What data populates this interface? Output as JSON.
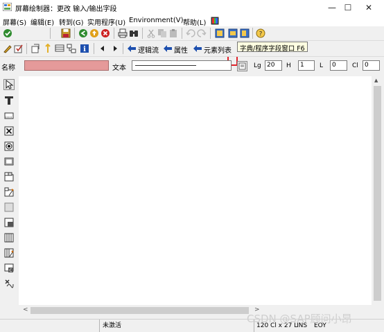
{
  "window": {
    "title": "屏幕绘制器：更改 输入/输出字段",
    "controls": {
      "minimize": "—",
      "maximize": "☐",
      "close": "✕"
    }
  },
  "menu": {
    "items": [
      "屏幕(S)",
      "编辑(E)",
      "转到(G)",
      "实用程序(U)",
      "Environment(V)",
      "帮助(L)"
    ]
  },
  "toolbar2": {
    "logic_flow": "逻辑流",
    "attributes": "属性",
    "element_list": "元素列表"
  },
  "tooltip": {
    "text": "字典/程序字段窗口  F6"
  },
  "attributes_row": {
    "name_label": "名称",
    "name_value": "",
    "text_label": "文本",
    "text_value": "",
    "lg_label": "Lg",
    "lg_value": "20",
    "h_label": "H",
    "h_value": "1",
    "l_label": "L",
    "l_value": "0",
    "cl_label": "Cl",
    "cl_value": "0"
  },
  "status": {
    "state": "未激活",
    "size": "120 Cl x 27 L",
    "ins": "INS",
    "eoy": "EOY"
  },
  "watermark": "CSDN @SAP顾问小昂",
  "colors": {
    "name_field_bg": "#e59a9a",
    "highlight_border": "#e0222a",
    "tooltip_bg": "#ffffe1"
  }
}
